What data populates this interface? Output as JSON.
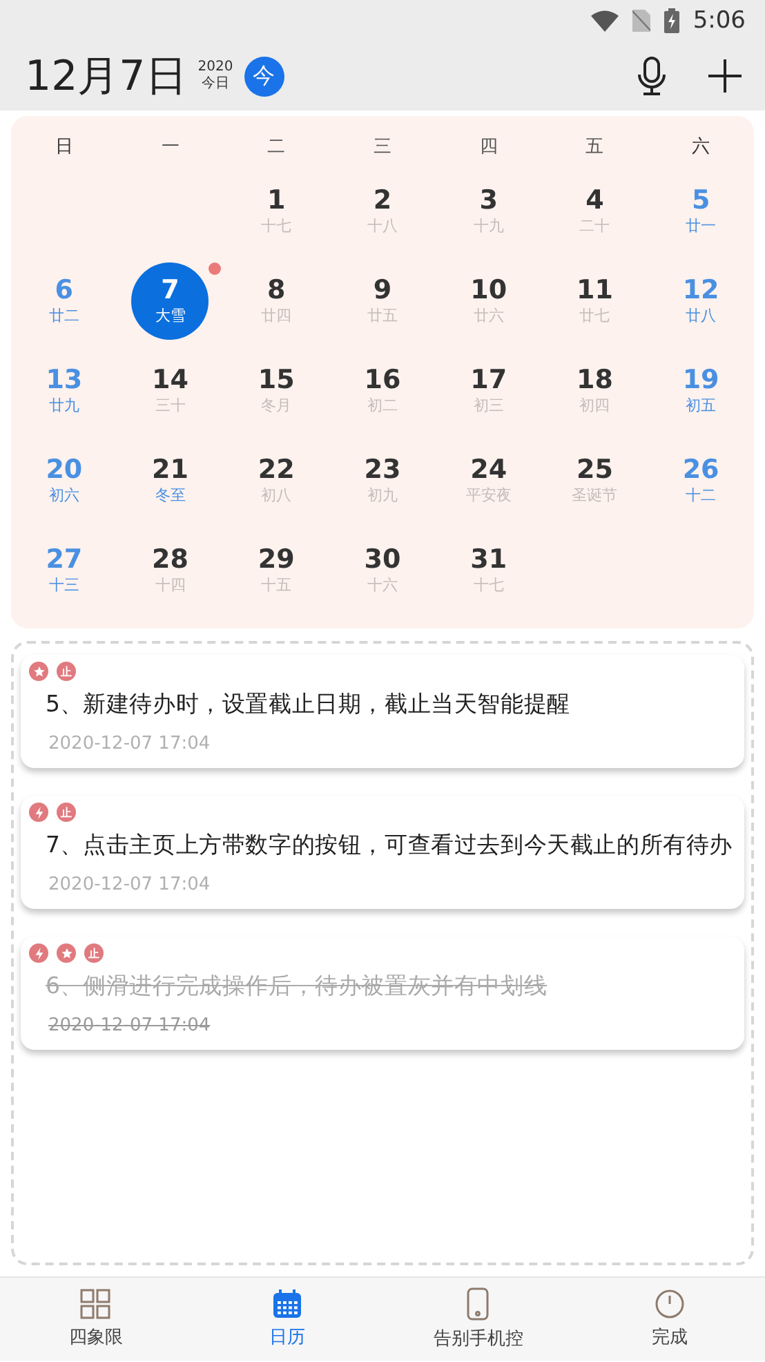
{
  "status_bar": {
    "time": "5:06"
  },
  "header": {
    "date": "12月7日",
    "year": "2020",
    "today_label": "今日",
    "today_button": "今"
  },
  "calendar": {
    "weekdays": [
      {
        "label": "日",
        "weekend": true
      },
      {
        "label": "一",
        "weekend": false
      },
      {
        "label": "二",
        "weekend": false
      },
      {
        "label": "三",
        "weekend": false
      },
      {
        "label": "四",
        "weekend": false
      },
      {
        "label": "五",
        "weekend": false
      },
      {
        "label": "六",
        "weekend": true
      }
    ],
    "days": [
      {
        "number": "1",
        "lunar": "十七",
        "weekend": false,
        "term": false,
        "selected": false,
        "dot": false
      },
      {
        "number": "2",
        "lunar": "十八",
        "weekend": false,
        "term": false,
        "selected": false,
        "dot": false
      },
      {
        "number": "3",
        "lunar": "十九",
        "weekend": false,
        "term": false,
        "selected": false,
        "dot": false
      },
      {
        "number": "4",
        "lunar": "二十",
        "weekend": false,
        "term": false,
        "selected": false,
        "dot": false
      },
      {
        "number": "5",
        "lunar": "廿一",
        "weekend": true,
        "term": false,
        "selected": false,
        "dot": false
      },
      {
        "number": "6",
        "lunar": "廿二",
        "weekend": true,
        "term": false,
        "selected": false,
        "dot": false
      },
      {
        "number": "7",
        "lunar": "大雪",
        "weekend": false,
        "term": true,
        "selected": true,
        "dot": true
      },
      {
        "number": "8",
        "lunar": "廿四",
        "weekend": false,
        "term": false,
        "selected": false,
        "dot": false
      },
      {
        "number": "9",
        "lunar": "廿五",
        "weekend": false,
        "term": false,
        "selected": false,
        "dot": false
      },
      {
        "number": "10",
        "lunar": "廿六",
        "weekend": false,
        "term": false,
        "selected": false,
        "dot": false
      },
      {
        "number": "11",
        "lunar": "廿七",
        "weekend": false,
        "term": false,
        "selected": false,
        "dot": false
      },
      {
        "number": "12",
        "lunar": "廿八",
        "weekend": true,
        "term": false,
        "selected": false,
        "dot": false
      },
      {
        "number": "13",
        "lunar": "廿九",
        "weekend": true,
        "term": false,
        "selected": false,
        "dot": false
      },
      {
        "number": "14",
        "lunar": "三十",
        "weekend": false,
        "term": false,
        "selected": false,
        "dot": false
      },
      {
        "number": "15",
        "lunar": "冬月",
        "weekend": false,
        "term": false,
        "selected": false,
        "dot": false
      },
      {
        "number": "16",
        "lunar": "初二",
        "weekend": false,
        "term": false,
        "selected": false,
        "dot": false
      },
      {
        "number": "17",
        "lunar": "初三",
        "weekend": false,
        "term": false,
        "selected": false,
        "dot": false
      },
      {
        "number": "18",
        "lunar": "初四",
        "weekend": false,
        "term": false,
        "selected": false,
        "dot": false
      },
      {
        "number": "19",
        "lunar": "初五",
        "weekend": true,
        "term": false,
        "selected": false,
        "dot": false
      },
      {
        "number": "20",
        "lunar": "初六",
        "weekend": true,
        "term": false,
        "selected": false,
        "dot": false
      },
      {
        "number": "21",
        "lunar": "冬至",
        "weekend": false,
        "term": true,
        "selected": false,
        "dot": false
      },
      {
        "number": "22",
        "lunar": "初八",
        "weekend": false,
        "term": false,
        "selected": false,
        "dot": false
      },
      {
        "number": "23",
        "lunar": "初九",
        "weekend": false,
        "term": false,
        "selected": false,
        "dot": false
      },
      {
        "number": "24",
        "lunar": "平安夜",
        "weekend": false,
        "term": false,
        "selected": false,
        "dot": false
      },
      {
        "number": "25",
        "lunar": "圣诞节",
        "weekend": false,
        "term": false,
        "selected": false,
        "dot": false
      },
      {
        "number": "26",
        "lunar": "十二",
        "weekend": true,
        "term": false,
        "selected": false,
        "dot": false
      },
      {
        "number": "27",
        "lunar": "十三",
        "weekend": true,
        "term": false,
        "selected": false,
        "dot": false
      },
      {
        "number": "28",
        "lunar": "十四",
        "weekend": false,
        "term": false,
        "selected": false,
        "dot": false
      },
      {
        "number": "29",
        "lunar": "十五",
        "weekend": false,
        "term": false,
        "selected": false,
        "dot": false
      },
      {
        "number": "30",
        "lunar": "十六",
        "weekend": false,
        "term": false,
        "selected": false,
        "dot": false
      },
      {
        "number": "31",
        "lunar": "十七",
        "weekend": false,
        "term": false,
        "selected": false,
        "dot": false
      }
    ]
  },
  "todos": [
    {
      "tags": [
        {
          "kind": "star"
        },
        {
          "kind": "text",
          "text": "止"
        }
      ],
      "title": "5、新建待办时，设置截止日期，截止当天智能提醒",
      "time": "2020-12-07 17:04",
      "done": false
    },
    {
      "tags": [
        {
          "kind": "bolt"
        },
        {
          "kind": "text",
          "text": "止"
        }
      ],
      "title": "7、点击主页上方带数字的按钮，可查看过去到今天截止的所有待办",
      "time": "2020-12-07 17:04",
      "done": false
    },
    {
      "tags": [
        {
          "kind": "bolt"
        },
        {
          "kind": "star"
        },
        {
          "kind": "text",
          "text": "止"
        }
      ],
      "title": "6、侧滑进行完成操作后，待办被置灰并有中划线",
      "time": "2020-12-07 17:04",
      "done": true
    }
  ],
  "bottom_nav": [
    {
      "kind": "grid",
      "label": "四象限",
      "selected": false
    },
    {
      "kind": "calendar",
      "label": "日历",
      "selected": true
    },
    {
      "kind": "phone",
      "label": "告别手机控",
      "selected": false
    },
    {
      "kind": "clock",
      "label": "完成",
      "selected": false
    }
  ]
}
